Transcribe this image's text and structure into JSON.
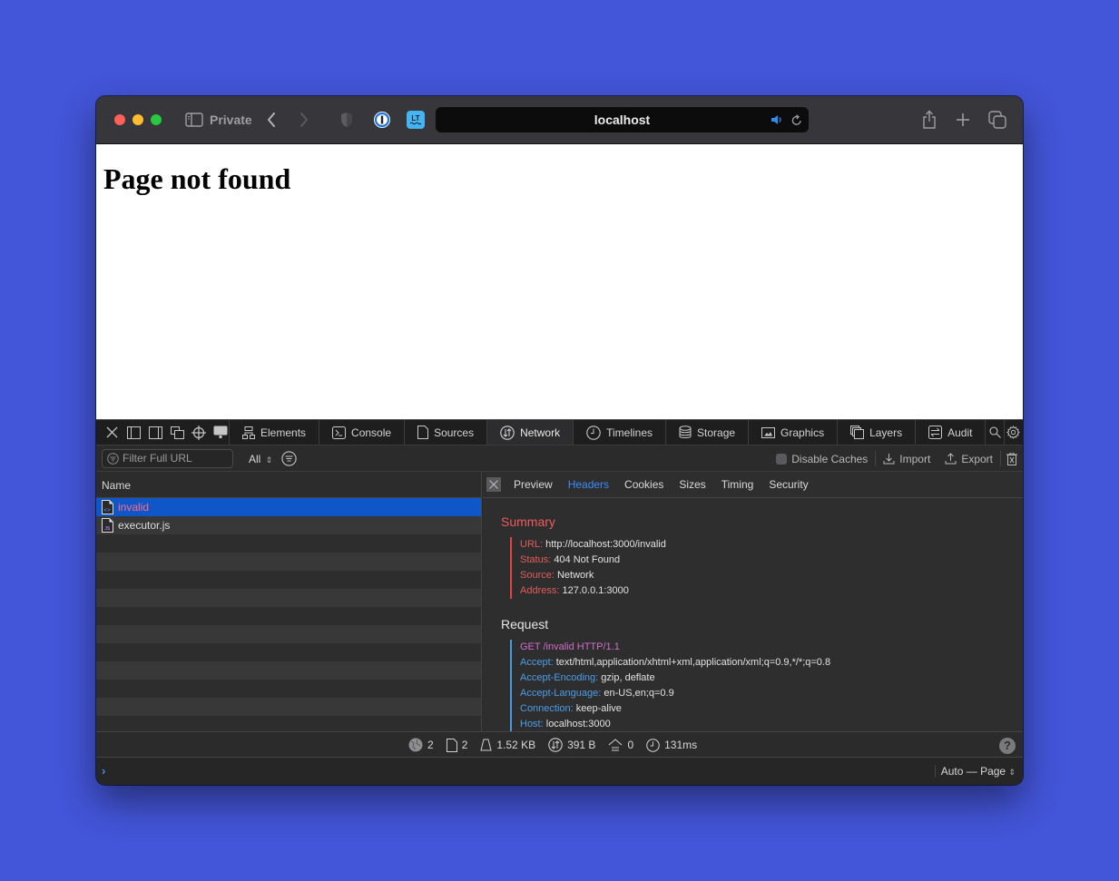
{
  "browser": {
    "private_label": "Private",
    "url": "localhost",
    "icons": [
      "sidebar-icon",
      "back-icon",
      "forward-icon",
      "shield-icon",
      "password-manager-icon",
      "languagetool-icon",
      "audio-icon",
      "reload-icon",
      "share-icon",
      "new-tab-icon",
      "tabs-overview-icon"
    ]
  },
  "page": {
    "heading": "Page not found"
  },
  "devtools": {
    "tabs": [
      {
        "label": "Elements",
        "icon": "elements-icon"
      },
      {
        "label": "Console",
        "icon": "console-icon"
      },
      {
        "label": "Sources",
        "icon": "sources-icon"
      },
      {
        "label": "Network",
        "icon": "network-icon",
        "active": true
      },
      {
        "label": "Timelines",
        "icon": "timelines-icon"
      },
      {
        "label": "Storage",
        "icon": "storage-icon"
      },
      {
        "label": "Graphics",
        "icon": "graphics-icon"
      },
      {
        "label": "Layers",
        "icon": "layers-icon"
      },
      {
        "label": "Audit",
        "icon": "audit-icon"
      }
    ],
    "filter": {
      "placeholder": "Filter Full URL",
      "type_select": "All",
      "disable_caches_label": "Disable Caches",
      "disable_caches_checked": false,
      "import_label": "Import",
      "export_label": "Export"
    },
    "list": {
      "header": "Name",
      "rows": [
        {
          "name": "invalid",
          "type": "document",
          "selected": true
        },
        {
          "name": "executor.js",
          "type": "script",
          "selected": false
        }
      ]
    },
    "details": {
      "tabs": [
        "Preview",
        "Headers",
        "Cookies",
        "Sizes",
        "Timing",
        "Security"
      ],
      "active_tab": "Headers",
      "summary": {
        "title": "Summary",
        "items": [
          {
            "key": "URL:",
            "value": "http://localhost:3000/invalid"
          },
          {
            "key": "Status:",
            "value": "404 Not Found"
          },
          {
            "key": "Source:",
            "value": "Network"
          },
          {
            "key": "Address:",
            "value": "127.0.0.1:3000"
          }
        ]
      },
      "request": {
        "title": "Request",
        "request_line": "GET /invalid HTTP/1.1",
        "items": [
          {
            "key": "Accept:",
            "value": "text/html,application/xhtml+xml,application/xml;q=0.9,*/*;q=0.8"
          },
          {
            "key": "Accept-Encoding:",
            "value": "gzip, deflate"
          },
          {
            "key": "Accept-Language:",
            "value": "en-US,en;q=0.9"
          },
          {
            "key": "Connection:",
            "value": "keep-alive"
          },
          {
            "key": "Host:",
            "value": "localhost:3000"
          }
        ]
      }
    },
    "status": {
      "domains": "2",
      "resources": "2",
      "size": "1.52 KB",
      "transferred": "391 B",
      "redirects": "0",
      "time": "131ms",
      "help": "?"
    },
    "console": {
      "prompt": "›",
      "context": "Auto — Page"
    }
  }
}
